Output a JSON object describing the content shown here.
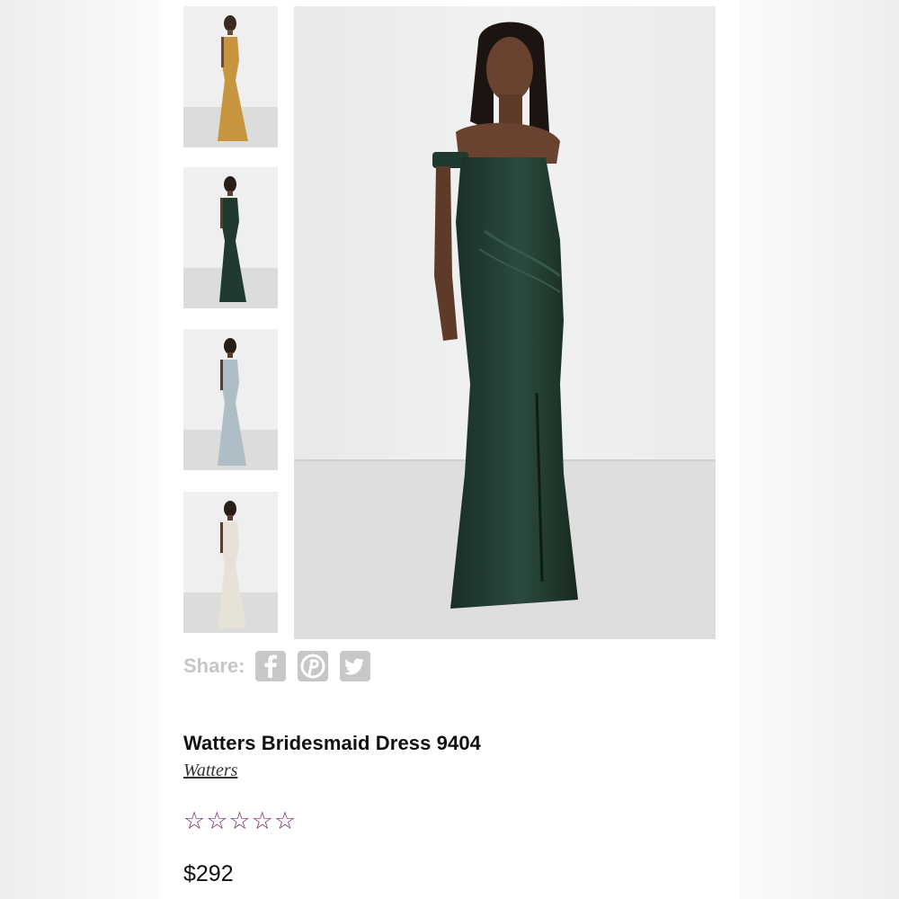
{
  "product": {
    "title": "Watters Bridesmaid Dress 9404",
    "brand": "Watters",
    "price": "$292",
    "rating": {
      "stars_filled": 0,
      "stars_total": 5,
      "star_glyph": "☆",
      "star_color": "#7a2a6e"
    }
  },
  "gallery": {
    "main_color": "#213a30",
    "thumbnails": [
      {
        "color_name": "gold",
        "dress_color": "#c8953f"
      },
      {
        "color_name": "green",
        "dress_color": "#213a30"
      },
      {
        "color_name": "light blue",
        "dress_color": "#aebdc6"
      },
      {
        "color_name": "ivory",
        "dress_color": "#e6e2d8"
      }
    ]
  },
  "share": {
    "label": "Share:",
    "icons": [
      "facebook-icon",
      "pinterest-icon",
      "twitter-icon"
    ],
    "icon_color": "#c7c7c7"
  }
}
